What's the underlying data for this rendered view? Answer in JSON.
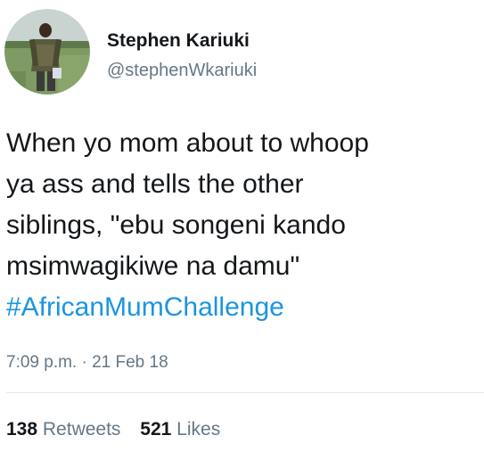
{
  "author": {
    "name": "Stephen Kariuki",
    "handle": "@stephenWkariuki"
  },
  "tweet": {
    "lines": [
      "When yo mom about to whoop",
      "ya ass and tells the other",
      "siblings, \"ebu songeni kando",
      "msimwagikiwe na damu\""
    ],
    "hashtag": "#AfricanMumChallenge",
    "timestamp": "7:09 p.m. · 21 Feb 18"
  },
  "stats": {
    "retweets_count": "138",
    "retweets_label": "Retweets",
    "likes_count": "521",
    "likes_label": "Likes"
  },
  "colors": {
    "hashtag": "#1b95e0",
    "secondary_text": "#657786",
    "primary_text": "#14171a"
  }
}
